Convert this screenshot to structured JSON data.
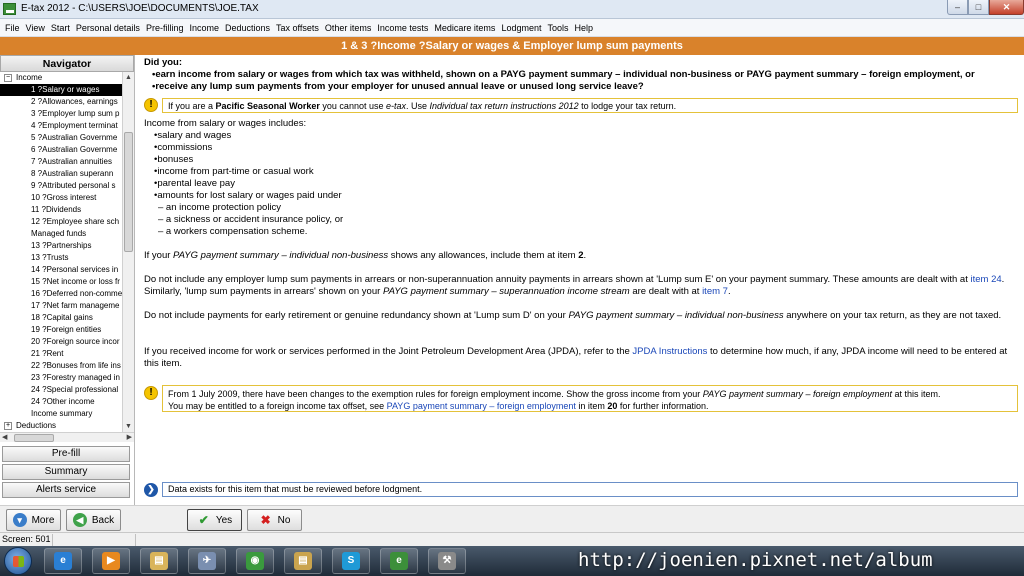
{
  "window": {
    "title": "E-tax 2012 - C:\\USERS\\JOE\\DOCUMENTS\\JOE.TAX",
    "min_glyph": "–",
    "max_glyph": "□",
    "close_glyph": "✕"
  },
  "menu": [
    "File",
    "View",
    "Start",
    "Personal details",
    "Pre-filling",
    "Income",
    "Deductions",
    "Tax offsets",
    "Other items",
    "Income tests",
    "Medicare items",
    "Lodgment",
    "Tools",
    "Help"
  ],
  "header": {
    "title": "1 & 3 ?Income ?Salary or wages & Employer lump sum payments"
  },
  "navigator": {
    "title": "Navigator",
    "group_income": "Income",
    "group_deductions": "Deductions",
    "expand_minus": "−",
    "expand_plus": "+",
    "items": [
      "1 ?Salary or wages",
      "2 ?Allowances, earnings",
      "3 ?Employer lump sum p",
      "4 ?Employment terminat",
      "5 ?Australian Governme",
      "6 ?Australian Governme",
      "7 ?Australian annuities",
      "8 ?Australian superann",
      "9 ?Attributed personal s",
      "10 ?Gross interest",
      "11 ?Dividends",
      "12 ?Employee share sch",
      "Managed funds",
      "13 ?Partnerships",
      "13 ?Trusts",
      "14 ?Personal services in",
      "15 ?Net income or loss fr",
      "16 ?Deferred non-comme",
      "17 ?Net farm manageme",
      "18 ?Capital gains",
      "19 ?Foreign entities",
      "20 ?Foreign source incor",
      "21 ?Rent",
      "22 ?Bonuses from life ins",
      "23 ?Forestry managed in",
      "24 ?Special professional",
      "24 ?Other income",
      "Income summary"
    ],
    "selected_index": 0,
    "buttons": {
      "prefill": "Pre-fill",
      "summary": "Summary",
      "alerts": "Alerts service"
    }
  },
  "content": {
    "did_you": "Did you:",
    "q1": "•earn income from salary or wages from which tax was withheld, shown on a PAYG payment summary – individual non-business or PAYG payment summary – foreign employment, or",
    "q2": "•receive any lump sum payments from your employer for unused annual leave or unused long service leave?",
    "warn_glyph": "!",
    "pacific_a": "If you are a ",
    "pacific_b": "Pacific Seasonal Worker",
    "pacific_c": " you cannot use ",
    "pacific_d": "e-tax",
    "pacific_e": ". Use ",
    "pacific_f": "Individual tax return instructions 2012",
    "pacific_g": " to lodge your tax return.",
    "includes_intro": "Income from salary or wages includes:",
    "includes": [
      "•salary and wages",
      "•commissions",
      "•bonuses",
      "•income from part-time or casual work",
      "•parental leave pay",
      "•amounts for lost salary or wages paid under"
    ],
    "sub_items": [
      "–  an income protection policy",
      "–  a sickness or accident insurance policy, or",
      "–  a workers compensation scheme."
    ],
    "p_allow_a": "If your ",
    "p_allow_b": "PAYG payment summary – individual non-business",
    "p_allow_c": " shows any allowances, include them at item ",
    "p_allow_d": "2",
    "p_allow_e": ".",
    "p_lump_a": "Do not include any employer lump sum payments in arrears or non-superannuation annuity payments in arrears shown at 'Lump sum E' on your payment summary. These amounts are dealt with at ",
    "p_lump_link1": "item 24",
    "p_lump_b": ". Similarly, 'lump sum payments in arrears' shown on your ",
    "p_lump_c": "PAYG payment summary – superannuation income stream",
    "p_lump_d": " are dealt with at ",
    "p_lump_link2": "item 7",
    "p_lump_e": ".",
    "p_retire_a": "Do not include payments for early retirement or genuine redundancy shown at 'Lump sum D' on your ",
    "p_retire_b": "PAYG payment summary – individual non-business",
    "p_retire_c": " anywhere on your tax return, as they are not taxed.",
    "p_jpda_a": "If you received income for work or services performed in the Joint Petroleum Development Area (JPDA), refer to the ",
    "p_jpda_link": "JPDA Instructions",
    "p_jpda_b": " to determine how much, if any, JPDA income will need to be entered at this item.",
    "foreign_a": "From 1 July 2009, there have been changes to the exemption rules for foreign employment income. Show the gross income from your ",
    "foreign_b": "PAYG payment summary – foreign employment",
    "foreign_c": " at this item.",
    "foreign_d": "You may be entitled to a foreign income tax offset, see ",
    "foreign_link": "PAYG payment summary – foreign employment",
    "foreign_e": " in item ",
    "foreign_f": "20",
    "foreign_g": " for further information.",
    "status_glyph": "❯",
    "status_message": "Data exists for this item that must be reviewed before lodgment."
  },
  "buttons": {
    "more": "More",
    "more_glyph": "▾",
    "back": "Back",
    "back_glyph": "◀",
    "yes": "Yes",
    "yes_glyph": "✔",
    "no": "No",
    "no_glyph": "✖"
  },
  "statusbar": {
    "screen": "Screen: 501"
  },
  "taskbar": {
    "apps": [
      {
        "icon": "internet-explorer-icon",
        "glyph": "e",
        "color": "#2a7fd4"
      },
      {
        "icon": "media-player-icon",
        "glyph": "▶",
        "color": "#e8891f"
      },
      {
        "icon": "folder-icon",
        "glyph": "▤",
        "color": "#d9b45a"
      },
      {
        "icon": "app-icon",
        "glyph": "✈",
        "color": "#7a8fb0"
      },
      {
        "icon": "chrome-icon",
        "glyph": "◉",
        "color": "#3a9a3e"
      },
      {
        "icon": "folder-icon",
        "glyph": "▤",
        "color": "#caa44e"
      },
      {
        "icon": "skype-icon",
        "glyph": "S",
        "color": "#1f9ad6"
      },
      {
        "icon": "etax-icon",
        "glyph": "e",
        "color": "#3c8f3a"
      },
      {
        "icon": "tool-icon",
        "glyph": "⚒",
        "color": "#8a8a8a"
      }
    ]
  },
  "watermark": "http://joenien.pixnet.net/album"
}
